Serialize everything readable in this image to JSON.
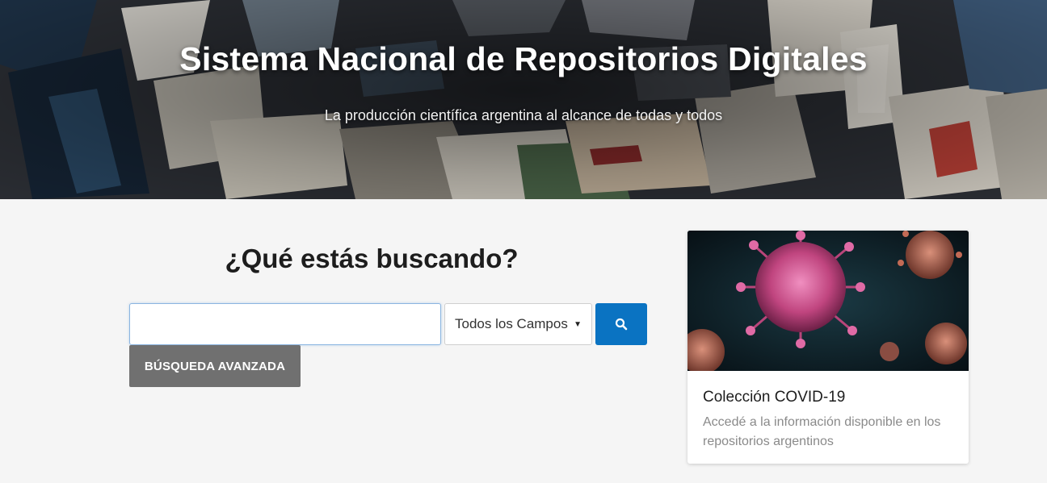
{
  "hero": {
    "title": "Sistema Nacional de Repositorios Digitales",
    "subtitle": "La producción científica argentina al alcance de todas y todos"
  },
  "search": {
    "heading": "¿Qué estás buscando?",
    "input_value": "",
    "input_placeholder": "",
    "field_selected": "Todos los Campos",
    "submit_icon": "search-icon",
    "advanced_label": "BÚSQUEDA AVANZADA",
    "accent_color": "#0a73c2"
  },
  "card": {
    "title": "Colección COVID-19",
    "description": "Accedé a la información disponible en los repositorios argentinos"
  }
}
